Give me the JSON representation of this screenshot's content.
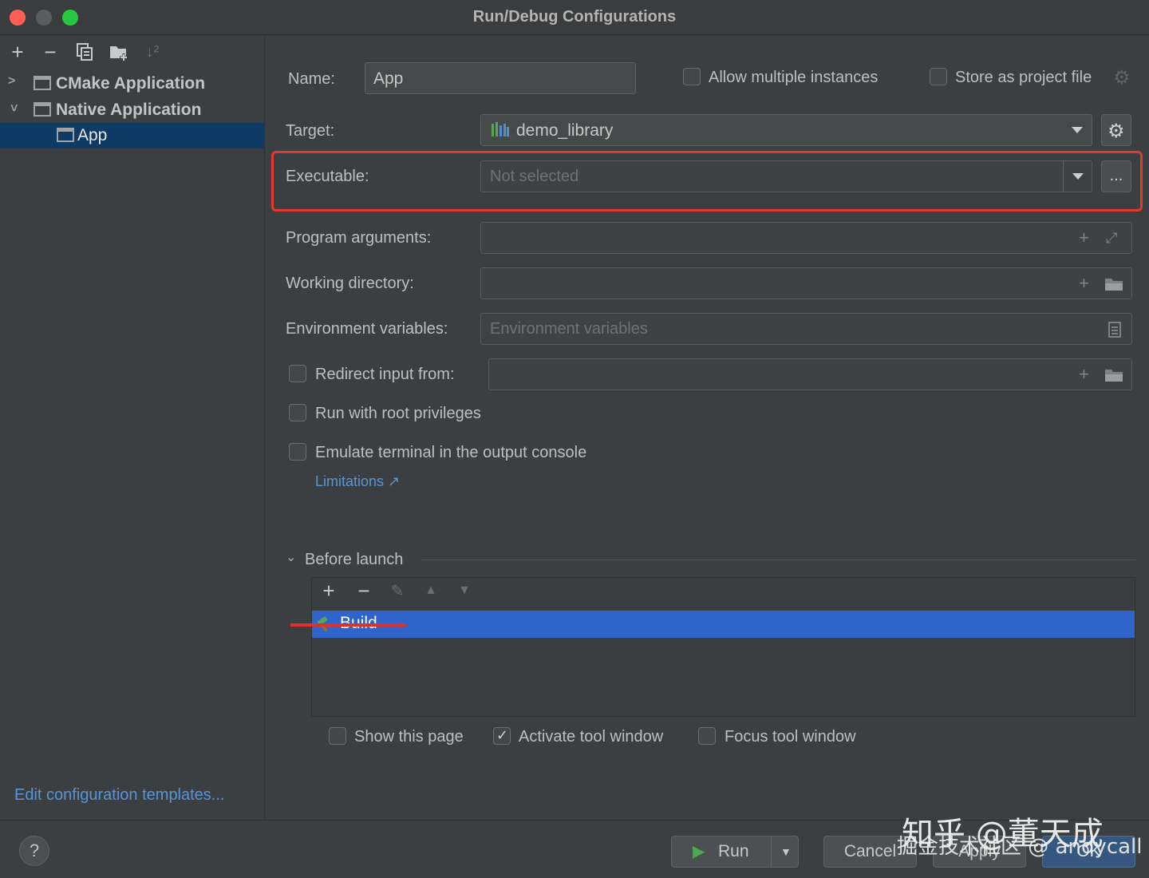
{
  "window": {
    "title": "Run/Debug Configurations"
  },
  "sidebar": {
    "toolbar": [
      "add-icon",
      "remove-icon",
      "copy-icon",
      "new-folder-icon",
      "sort-icon"
    ],
    "tree": [
      {
        "label": "CMake Application",
        "expanded": false
      },
      {
        "label": "Native Application",
        "expanded": true
      },
      {
        "label": "App",
        "selected": true
      }
    ],
    "edit_templates": "Edit configuration templates..."
  },
  "form": {
    "name_label": "Name:",
    "name_value": "App",
    "allow_multiple": {
      "label": "Allow multiple instances",
      "checked": false
    },
    "store_project": {
      "label": "Store as project file",
      "checked": false
    },
    "target_label": "Target:",
    "target_value": "demo_library",
    "executable_label": "Executable:",
    "executable_value": "Not selected",
    "executable_browse": "...",
    "program_args_label": "Program arguments:",
    "working_dir_label": "Working directory:",
    "env_label": "Environment variables:",
    "env_placeholder": "Environment variables",
    "redirect": {
      "label": "Redirect input from:",
      "checked": false
    },
    "root": {
      "label": "Run with root privileges",
      "checked": false
    },
    "emulate": {
      "label": "Emulate terminal in the output console",
      "checked": false
    },
    "limitations": "Limitations ↗"
  },
  "before_launch": {
    "title": "Before launch",
    "items": [
      {
        "label": "Build",
        "selected": true
      }
    ],
    "show_page": {
      "label": "Show this page",
      "checked": false
    },
    "activate": {
      "label": "Activate tool window",
      "checked": true
    },
    "focus": {
      "label": "Focus tool window",
      "checked": false
    }
  },
  "footer": {
    "help": "?",
    "run": "Run",
    "cancel": "Cancel",
    "apply": "Apply",
    "ok": "OK"
  },
  "watermark": {
    "line1": "知乎 @董天成",
    "line2": "掘金技术社区 @ andycall"
  },
  "colors": {
    "accent_link": "#5795d6",
    "selection": "#2f65ca",
    "highlight_box": "#e03a2c",
    "primary_button": "#365880"
  }
}
